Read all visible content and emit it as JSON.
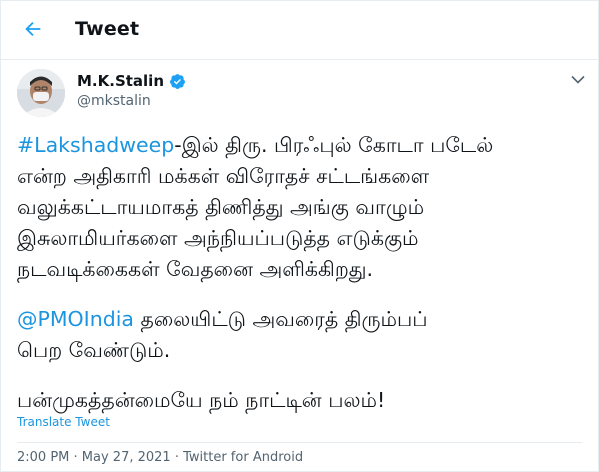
{
  "header": {
    "title": "Tweet",
    "back_icon": "arrow-left-icon",
    "accent": "#1da1f2"
  },
  "author": {
    "name": "M.K.Stalin",
    "handle": "@mkstalin",
    "verified_icon": "verified-badge-icon"
  },
  "tweet": {
    "hashtag": "#Lakshadweep",
    "line1_rest": "-இல் திரு. பிரஃபுல் கோடா படேல்",
    "line2": "என்ற அதிகாரி மக்கள் விரோதச் சட்டங்களை",
    "line3": "வலுக்கட்டாயமாகத் திணித்து அங்கு வாழும்",
    "line4": "இசுலாமியர்களை அந்நியப்படுத்த எடுக்கும்",
    "line5": "நடவடிக்கைகள் வேதனை அளிக்கிறது.",
    "mention": "@PMOIndia",
    "line6_rest": " தலையிட்டு அவரைத் திரும்பப்",
    "line7": "பெற வேண்டும்.",
    "line8": "பன்முகத்தன்மையே நம் நாட்டின் பலம்!"
  },
  "translate_label": "Translate Tweet",
  "meta": {
    "time": "2:00 PM",
    "sep": " · ",
    "date": "May 27, 2021",
    "sep2": " · ",
    "source": "Twitter for Android"
  },
  "colors": {
    "link": "#1b95e0",
    "secondary": "#536471",
    "verified": "#1da1f2"
  }
}
